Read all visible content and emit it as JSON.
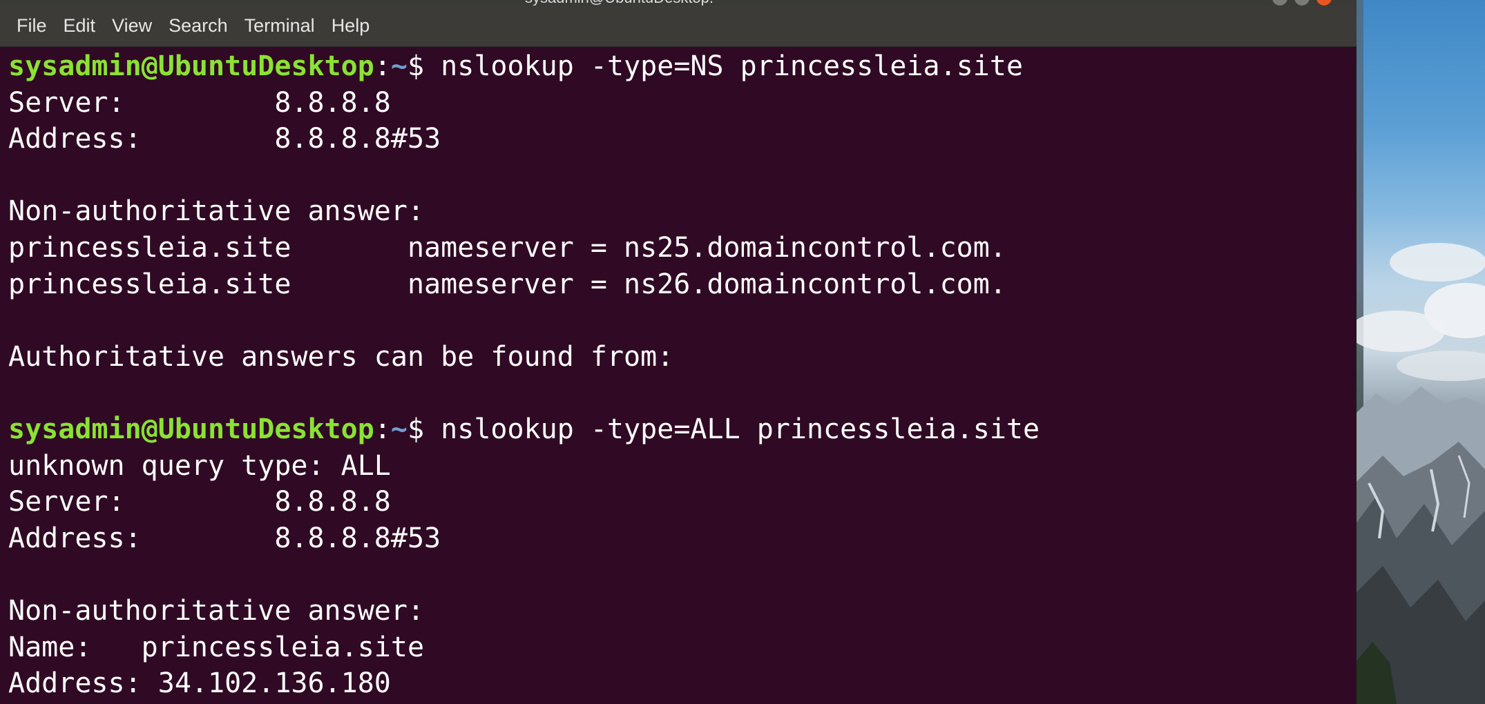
{
  "window": {
    "title": "sysadmin@UbuntuDesktop: ~"
  },
  "menu": {
    "items": [
      "File",
      "Edit",
      "View",
      "Search",
      "Terminal",
      "Help"
    ]
  },
  "colors": {
    "terminal_bg": "#300a24",
    "prompt_user": "#8ae234",
    "prompt_path": "#729fcf",
    "text": "#ffffff",
    "close_button": "#e95420"
  },
  "prompt": {
    "user_host": "sysadmin@UbuntuDesktop",
    "colon": ":",
    "path": "~",
    "dollar": "$ "
  },
  "terminal": {
    "lines": [
      {
        "type": "prompt",
        "command": "nslookup -type=NS princessleia.site"
      },
      {
        "type": "output",
        "text": "Server:\t\t8.8.8.8"
      },
      {
        "type": "output",
        "text": "Address:\t8.8.8.8#53"
      },
      {
        "type": "output",
        "text": ""
      },
      {
        "type": "output",
        "text": "Non-authoritative answer:"
      },
      {
        "type": "output",
        "text": "princessleia.site\tnameserver = ns25.domaincontrol.com."
      },
      {
        "type": "output",
        "text": "princessleia.site\tnameserver = ns26.domaincontrol.com."
      },
      {
        "type": "output",
        "text": ""
      },
      {
        "type": "output",
        "text": "Authoritative answers can be found from:"
      },
      {
        "type": "output",
        "text": ""
      },
      {
        "type": "prompt",
        "command": "nslookup -type=ALL princessleia.site"
      },
      {
        "type": "output",
        "text": "unknown query type: ALL"
      },
      {
        "type": "output",
        "text": "Server:\t\t8.8.8.8"
      },
      {
        "type": "output",
        "text": "Address:\t8.8.8.8#53"
      },
      {
        "type": "output",
        "text": ""
      },
      {
        "type": "output",
        "text": "Non-authoritative answer:"
      },
      {
        "type": "output",
        "text": "Name:\tprincessleia.site"
      },
      {
        "type": "output",
        "text": "Address: 34.102.136.180"
      }
    ]
  }
}
